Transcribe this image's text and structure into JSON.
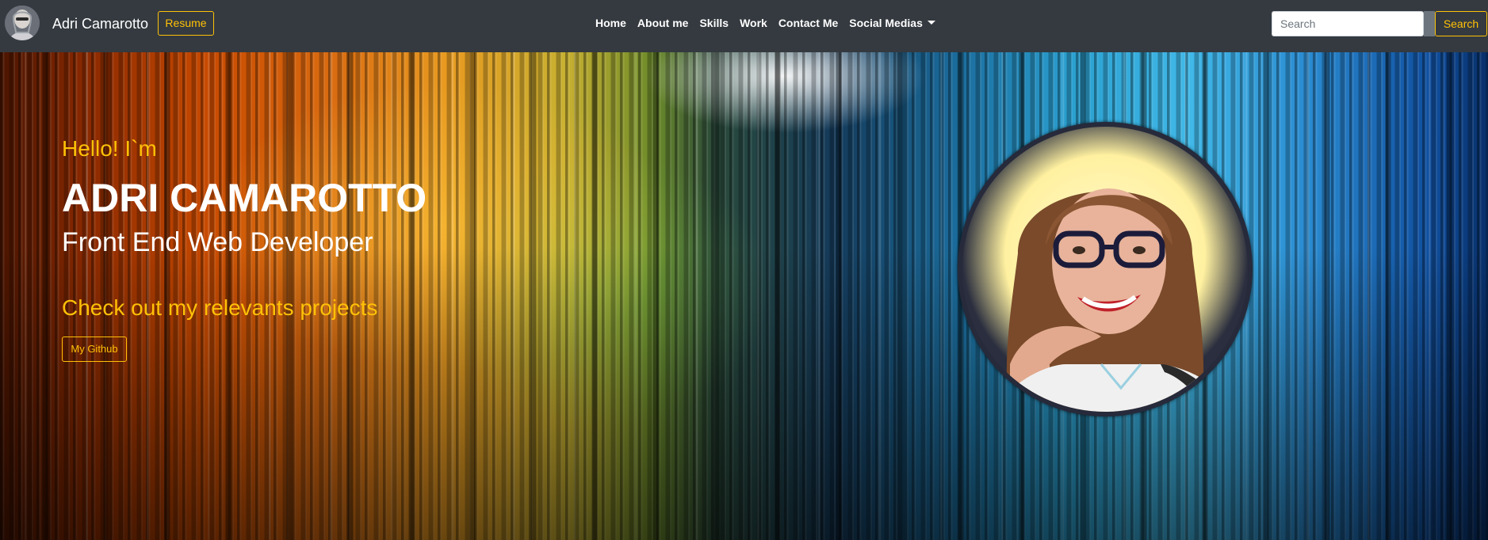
{
  "navbar": {
    "brand_name": "Adri Camarotto",
    "resume_label": "Resume",
    "links": [
      "Home",
      "About me",
      "Skills",
      "Work",
      "Contact Me"
    ],
    "dropdown_label": "Social Medias",
    "search_placeholder": "Search",
    "search_button_label": "Search"
  },
  "hero": {
    "greeting": "Hello! I`m",
    "name": "ADRI CAMAROTTO",
    "role": "Front End Web Developer",
    "projects_heading": "Check out my relevants projects",
    "github_button_label": "My Github"
  },
  "colors": {
    "navbar_bg": "#343a40",
    "accent": "#ffc107",
    "text_light": "#ffffff"
  },
  "icons": {
    "brand_avatar": "avatar",
    "dropdown": "caret-down-icon",
    "portrait": "profile-photo"
  }
}
